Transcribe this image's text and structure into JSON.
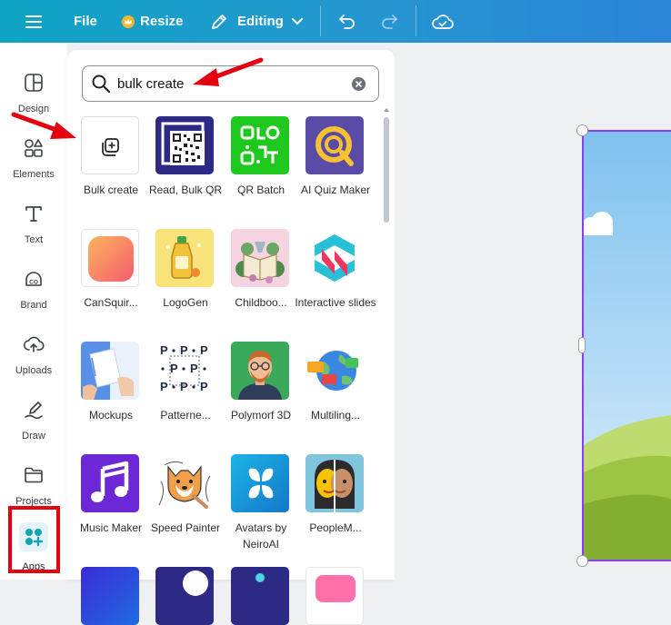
{
  "topbar": {
    "menu_icon": "hamburger-icon",
    "file_label": "File",
    "resize_label": "Resize",
    "editing_label": "Editing",
    "colors": {
      "from": "#0fa4c4",
      "to": "#2b84d8"
    }
  },
  "rail": {
    "items": [
      {
        "label": "Design",
        "icon": "design-icon"
      },
      {
        "label": "Elements",
        "icon": "elements-icon"
      },
      {
        "label": "Text",
        "icon": "text-icon"
      },
      {
        "label": "Brand",
        "icon": "brand-icon"
      },
      {
        "label": "Uploads",
        "icon": "uploads-icon"
      },
      {
        "label": "Draw",
        "icon": "draw-icon"
      },
      {
        "label": "Projects",
        "icon": "folder-icon"
      },
      {
        "label": "Apps",
        "icon": "apps-icon"
      }
    ]
  },
  "search": {
    "value": "bulk create",
    "icon": "search-icon"
  },
  "apps": [
    {
      "label": "Bulk create"
    },
    {
      "label": "Read, Bulk QR"
    },
    {
      "label": "QR Batch"
    },
    {
      "label": "AI Quiz Maker"
    },
    {
      "label": "CanSquir..."
    },
    {
      "label": "LogoGen"
    },
    {
      "label": "Childboo..."
    },
    {
      "label": "Interactive slides"
    },
    {
      "label": "Mockups"
    },
    {
      "label": "Patterne..."
    },
    {
      "label": "Polymorf 3D"
    },
    {
      "label": "Multiling..."
    },
    {
      "label": "Music Maker"
    },
    {
      "label": "Speed Painter"
    },
    {
      "label": "Avatars by NeiroAI"
    },
    {
      "label": "PeopleM..."
    }
  ],
  "annotation_color": "#e3000f"
}
